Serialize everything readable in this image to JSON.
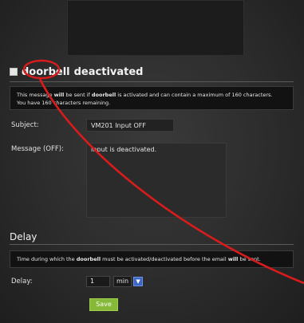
{
  "section": {
    "word": "doorbell",
    "rest": "deactivated"
  },
  "info": {
    "line1_pre": "This message ",
    "line1_will": "will",
    "line1_mid": " be sent if ",
    "line1_doorbell": "doorbell",
    "line1_post": " is activated and can contain a maximum of 160 characters.",
    "line2": "You have 160 characters remaining."
  },
  "subject": {
    "label": "Subject:",
    "value": "VM201 Input OFF"
  },
  "message": {
    "label": "Message (OFF):",
    "value": "Input is deactivated."
  },
  "delay": {
    "title": "Delay",
    "info_pre": "Time during which the ",
    "info_doorbell": "doorbell",
    "info_mid": " must be activated/deactivated before the email ",
    "info_will": "will",
    "info_post": " be sent.",
    "label": "Delay:",
    "value": "1",
    "unit": "min"
  },
  "save_label": "Save",
  "colors": {
    "annotation": "#d81c1c",
    "save_button": "#86b83a",
    "select_arrow": "#3b66c4"
  }
}
